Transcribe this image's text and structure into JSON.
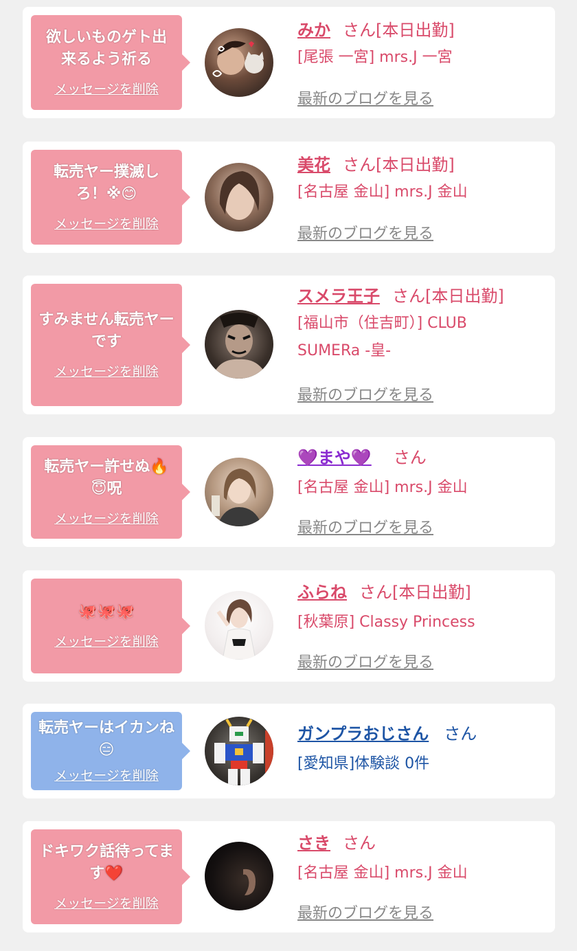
{
  "colors": {
    "page_bg": "#f0f0f0",
    "card_bg": "#ffffff",
    "bubble_pink": "#f29aa6",
    "bubble_blue": "#8fb3ea",
    "name_pink": "#d94a6a",
    "name_blue": "#1e55a5",
    "blog_gray": "#888888"
  },
  "delete_label": "メッセージを削除",
  "blog_label": "最新のブログを見る",
  "cards": [
    {
      "message": "欲しいものゲト出来るよう祈る",
      "name": "みか",
      "suffix": "さん[本日出勤]",
      "shop": "[尾張 一宮] mrs.J 一宮",
      "avatar_icon": "woman-with-cat-photo",
      "has_blog": true
    },
    {
      "message": "転売ヤー撲滅しろ！※😊",
      "name": "美花",
      "suffix": "さん[本日出勤]",
      "shop": "[名古屋 金山] mrs.J 金山",
      "avatar_icon": "woman-portrait-photo",
      "has_blog": true
    },
    {
      "message": "すみません転売ヤーです",
      "name": "スメラ王子",
      "suffix": "さん[本日出勤]",
      "shop": "[福山市（住吉町）] CLUB SUMERa -皇-",
      "avatar_icon": "kabuki-man-photo",
      "has_blog": true
    },
    {
      "message": "転売ヤー許せぬ🔥😇呪",
      "name": "💜まや💜",
      "suffix": "さん",
      "shop": "[名古屋 金山] mrs.J 金山",
      "avatar_icon": "woman-smiling-photo",
      "has_blog": true
    },
    {
      "message": "🐙🐙🐙",
      "name": "ふらね",
      "suffix": "さん[本日出勤]",
      "shop": "[秋葉原] Classy Princess",
      "avatar_icon": "woman-posing-photo",
      "has_blog": true
    },
    {
      "message": "転売ヤーはイカンね😑",
      "name": "ガンプラおじさん",
      "suffix": "さん",
      "shop": "[愛知県]体験談 0件",
      "avatar_icon": "gundam-model-photo",
      "has_blog": false
    },
    {
      "message": "ドキワク話待ってます❤️",
      "name": "さき",
      "suffix": "さん",
      "shop": "[名古屋 金山] mrs.J 金山",
      "avatar_icon": "dark-ear-closeup-photo",
      "has_blog": true
    }
  ]
}
